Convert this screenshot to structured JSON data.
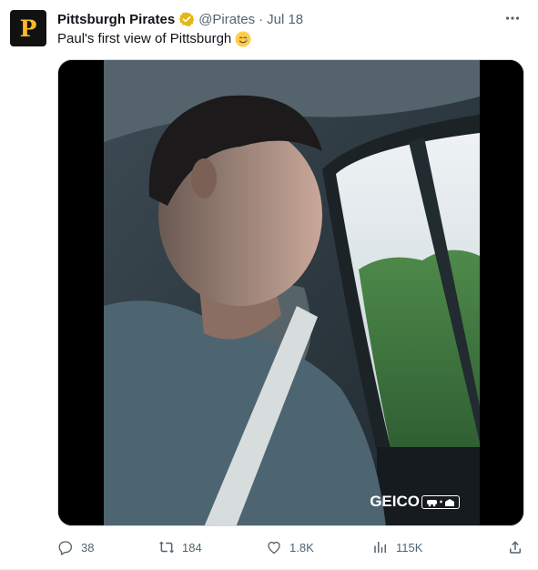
{
  "account": {
    "display_name": "Pittsburgh Pirates",
    "handle": "@Pirates",
    "separator": "·",
    "date": "Jul 18",
    "avatar_letter": "P",
    "verified": true
  },
  "tweet": {
    "text": "Paul's first view of Pittsburgh",
    "emoji": "smiling-face-with-tear",
    "media_watermark": "GEICO"
  },
  "actions": {
    "replies": "38",
    "reposts": "184",
    "likes": "1.8K",
    "views": "115K"
  },
  "colors": {
    "secondary_text": "#536471",
    "brand_gold": "#FDB827",
    "verified_gold": "#E2B719"
  }
}
